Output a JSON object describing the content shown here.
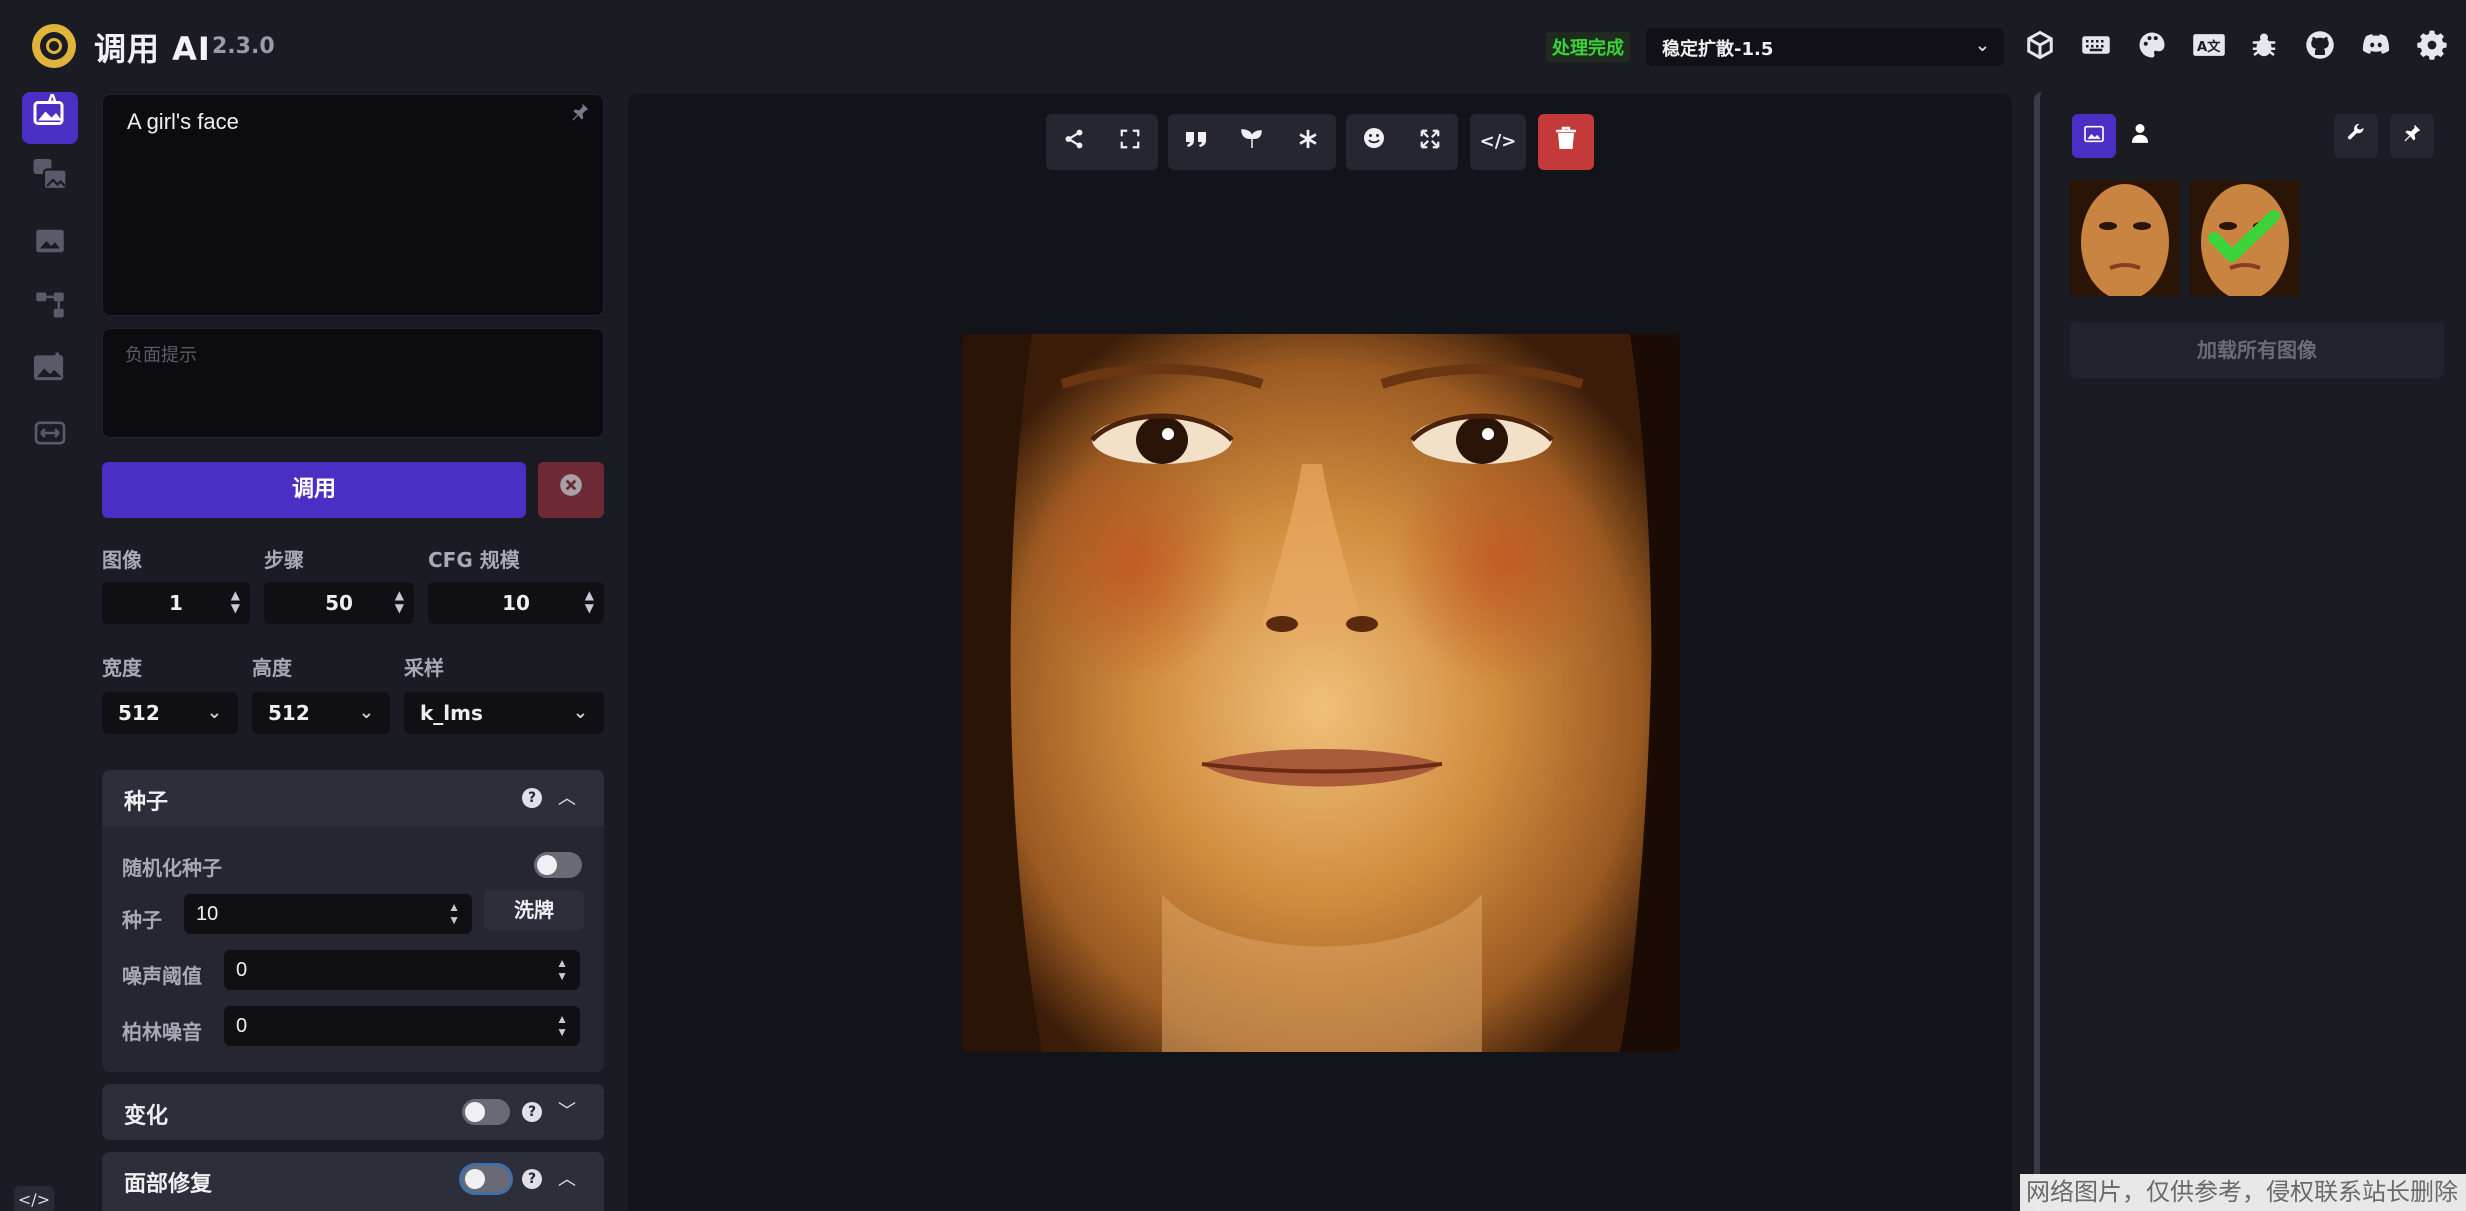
{
  "header": {
    "title": "调用 AI",
    "version": "2.3.0",
    "status": "处理完成",
    "model": "稳定扩散-1.5",
    "icons": [
      "cube-icon",
      "keyboard-icon",
      "palette-icon",
      "translate-icon",
      "bug-icon",
      "github-icon",
      "discord-icon",
      "gear-icon"
    ]
  },
  "nav": {
    "items": [
      "text-to-image-icon",
      "image-to-image-icon",
      "inpainting-icon",
      "nodes-icon",
      "outpainting-icon",
      "training-icon"
    ]
  },
  "prompt": {
    "value": "A girl's face",
    "negative_placeholder": "负面提示"
  },
  "actions": {
    "invoke_label": "调用"
  },
  "params": {
    "images_label": "图像",
    "images_value": "1",
    "steps_label": "步骤",
    "steps_value": "50",
    "cfg_label": "CFG 规模",
    "cfg_value": "10",
    "width_label": "宽度",
    "width_value": "512",
    "height_label": "高度",
    "height_value": "512",
    "sampler_label": "采样",
    "sampler_value": "k_lms"
  },
  "seed_section": {
    "title": "种子",
    "random_label": "随机化种子",
    "seed_label": "种子",
    "seed_value": "10",
    "shuffle_label": "洗牌",
    "threshold_label": "噪声阈值",
    "threshold_value": "0",
    "perlin_label": "柏林噪音",
    "perlin_value": "0"
  },
  "variation_section": {
    "title": "变化"
  },
  "face_section": {
    "title": "面部修复"
  },
  "gallery": {
    "load_all_label": "加载所有图像"
  },
  "watermark": "网络图片，仅供参考，侵权联系站长删除",
  "colors": {
    "accent": "#4b2fc4",
    "status": "#3ad43a",
    "danger": "#c43a3a",
    "brand": "#e0b33a"
  }
}
